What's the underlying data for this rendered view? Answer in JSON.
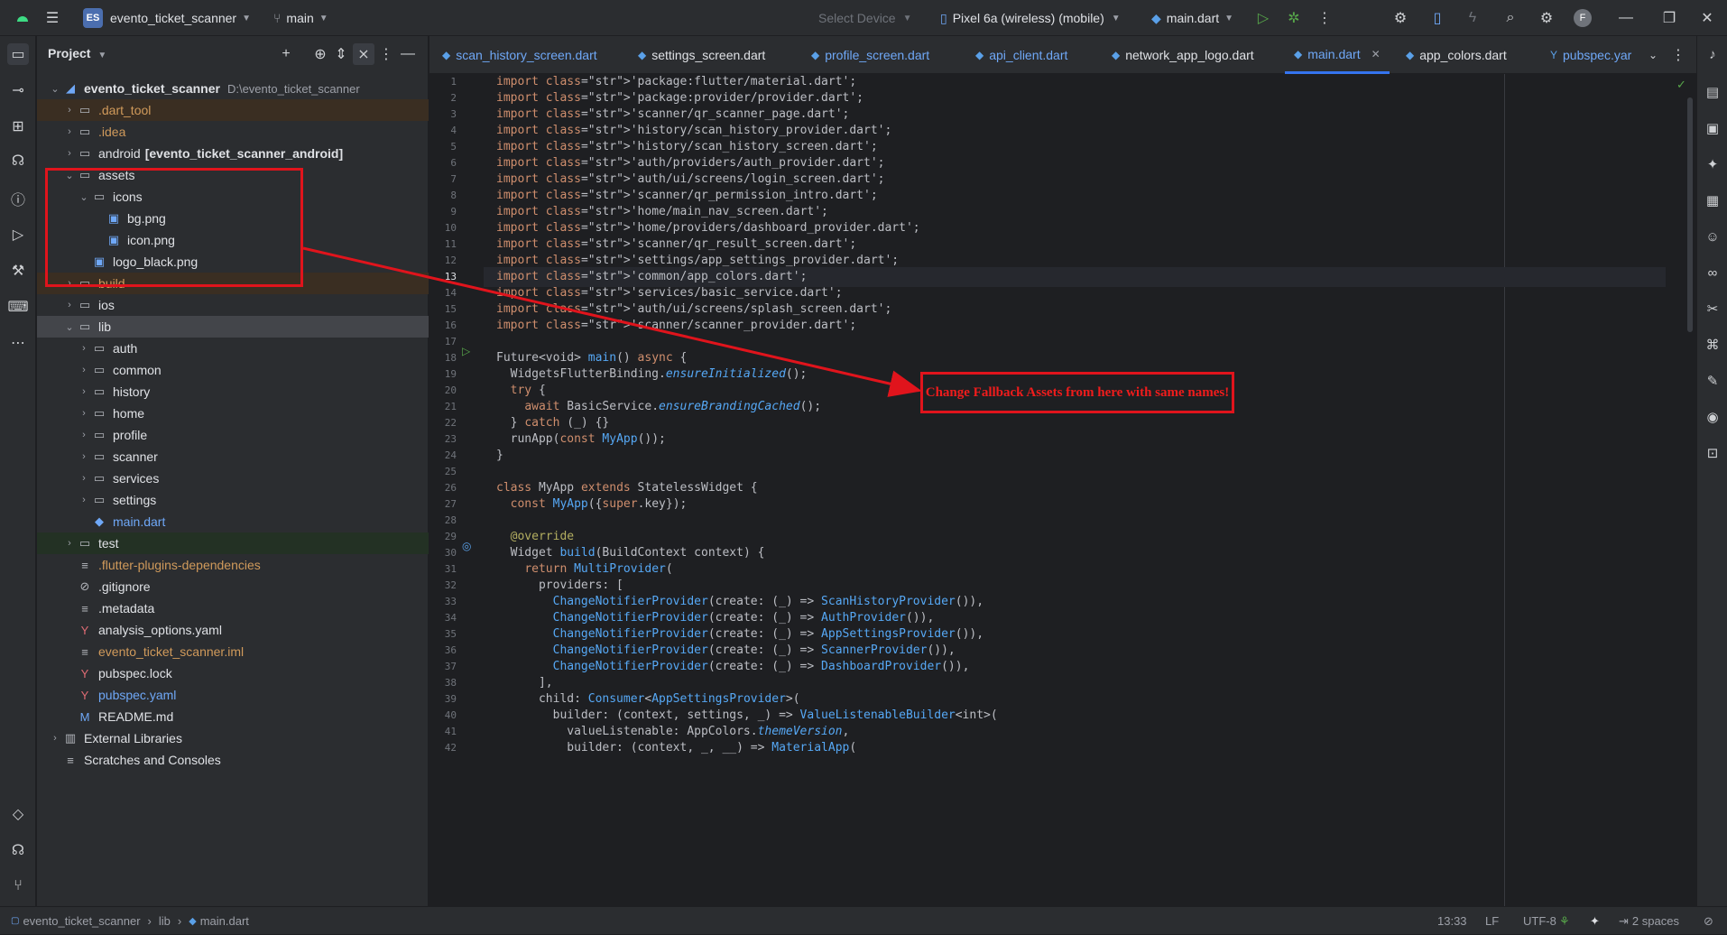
{
  "titlebar": {
    "project_badge": "ES",
    "project_name": "evento_ticket_scanner",
    "branch": "main",
    "select_device": "Select Device",
    "device": "Pixel 6a (wireless) (mobile)",
    "run_config": "main.dart",
    "avatar": "F",
    "icons": [
      "menu-icon",
      "branch-icon",
      "device-icon",
      "dart-icon",
      "run-icon",
      "debug-icon",
      "more-icon",
      "bug-icon",
      "phone-icon",
      "flash-icon",
      "search-icon",
      "gear-icon",
      "minimize-icon",
      "restore-icon",
      "close-icon"
    ]
  },
  "project_panel": {
    "title": "Project",
    "root_name": "evento_ticket_scanner",
    "root_path": "D:\\evento_ticket_scanner",
    "items": [
      {
        "label": ".dart_tool",
        "extra": ""
      },
      {
        "label": ".idea",
        "extra": ""
      },
      {
        "label": "android",
        "extra": "[evento_ticket_scanner_android]"
      },
      {
        "label": "assets",
        "extra": ""
      },
      {
        "label": "icons",
        "extra": ""
      },
      {
        "label": "bg.png",
        "extra": ""
      },
      {
        "label": "icon.png",
        "extra": ""
      },
      {
        "label": "logo_black.png",
        "extra": ""
      },
      {
        "label": "build",
        "extra": ""
      },
      {
        "label": "ios",
        "extra": ""
      },
      {
        "label": "lib",
        "extra": ""
      },
      {
        "label": "auth",
        "extra": ""
      },
      {
        "label": "common",
        "extra": ""
      },
      {
        "label": "history",
        "extra": ""
      },
      {
        "label": "home",
        "extra": ""
      },
      {
        "label": "profile",
        "extra": ""
      },
      {
        "label": "scanner",
        "extra": ""
      },
      {
        "label": "services",
        "extra": ""
      },
      {
        "label": "settings",
        "extra": ""
      },
      {
        "label": "main.dart",
        "extra": ""
      },
      {
        "label": "test",
        "extra": ""
      },
      {
        "label": ".flutter-plugins-dependencies",
        "extra": ""
      },
      {
        "label": ".gitignore",
        "extra": ""
      },
      {
        "label": ".metadata",
        "extra": ""
      },
      {
        "label": "analysis_options.yaml",
        "extra": ""
      },
      {
        "label": "evento_ticket_scanner.iml",
        "extra": ""
      },
      {
        "label": "pubspec.lock",
        "extra": ""
      },
      {
        "label": "pubspec.yaml",
        "extra": ""
      },
      {
        "label": "README.md",
        "extra": ""
      },
      {
        "label": "External Libraries",
        "extra": ""
      },
      {
        "label": "Scratches and Consoles",
        "extra": ""
      }
    ]
  },
  "tabs": [
    "scan_history_screen.dart",
    "settings_screen.dart",
    "profile_screen.dart",
    "api_client.dart",
    "network_app_logo.dart",
    "main.dart",
    "app_colors.dart",
    "pubspec.yar"
  ],
  "code_lines": [
    "import 'package:flutter/material.dart';",
    "import 'package:provider/provider.dart';",
    "import 'scanner/qr_scanner_page.dart';",
    "import 'history/scan_history_provider.dart';",
    "import 'history/scan_history_screen.dart';",
    "import 'auth/providers/auth_provider.dart';",
    "import 'auth/ui/screens/login_screen.dart';",
    "import 'scanner/qr_permission_intro.dart';",
    "import 'home/main_nav_screen.dart';",
    "import 'home/providers/dashboard_provider.dart';",
    "import 'scanner/qr_result_screen.dart';",
    "import 'settings/app_settings_provider.dart';",
    "import 'common/app_colors.dart';",
    "import 'services/basic_service.dart';",
    "import 'auth/ui/screens/splash_screen.dart';",
    "import 'scanner/scanner_provider.dart';",
    "",
    "Future<void> main() async {",
    "  WidgetsFlutterBinding.ensureInitialized();",
    "  try {",
    "    await BasicService.ensureBrandingCached();",
    "  } catch (_) {}",
    "  runApp(const MyApp());",
    "}",
    "",
    "class MyApp extends StatelessWidget {",
    "  const MyApp({super.key});",
    "",
    "  @override",
    "  Widget build(BuildContext context) {",
    "    return MultiProvider(",
    "      providers: [",
    "        ChangeNotifierProvider(create: (_) => ScanHistoryProvider()),",
    "        ChangeNotifierProvider(create: (_) => AuthProvider()),",
    "        ChangeNotifierProvider(create: (_) => AppSettingsProvider()),",
    "        ChangeNotifierProvider(create: (_) => ScannerProvider()),",
    "        ChangeNotifierProvider(create: (_) => DashboardProvider()),",
    "      ],",
    "      child: Consumer<AppSettingsProvider>(",
    "        builder: (context, settings, _) => ValueListenableBuilder<int>(",
    "          valueListenable: AppColors.themeVersion,",
    "          builder: (context, _, __) => MaterialApp("
  ],
  "line_numbers": [
    "1",
    "2",
    "3",
    "4",
    "5",
    "6",
    "7",
    "8",
    "9",
    "10",
    "11",
    "12",
    "13",
    "14",
    "15",
    "16",
    "17",
    "18",
    "19",
    "20",
    "21",
    "22",
    "23",
    "24",
    "25",
    "26",
    "27",
    "28",
    "29",
    "30",
    "31",
    "32",
    "33",
    "34",
    "35",
    "36",
    "37",
    "38",
    "39",
    "40",
    "41",
    "42"
  ],
  "annotation": "Change Fallback Assets from here with same names!",
  "statusbar": {
    "project": "evento_ticket_scanner",
    "folder": "lib",
    "file": "main.dart",
    "position": "13:33",
    "line_sep": "LF",
    "encoding": "UTF-8",
    "indent": "2 spaces"
  },
  "colors": {
    "accent": "#3574f0",
    "annotation_red": "#e0141c",
    "bg": "#1e1f22",
    "panel": "#2b2d30"
  }
}
